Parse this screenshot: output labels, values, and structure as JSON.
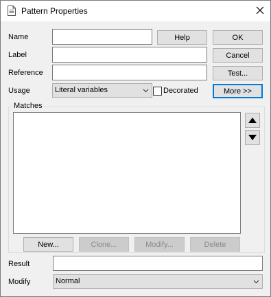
{
  "window": {
    "title": "Pattern Properties"
  },
  "icons": {
    "title_icon": "document-icon",
    "close_icon": "close-icon",
    "up_icon": "arrow-up-icon",
    "down_icon": "arrow-down-icon",
    "dropdown_icon": "chevron-down-icon"
  },
  "form": {
    "name_label": "Name",
    "name_value": "",
    "label_label": "Label",
    "label_value": "",
    "reference_label": "Reference",
    "reference_value": "",
    "usage_label": "Usage",
    "usage_selected": "Literal variables",
    "decorated_label": "Decorated",
    "decorated_checked": false,
    "result_label": "Result",
    "result_value": "",
    "modify_label": "Modify",
    "modify_selected": "Normal"
  },
  "buttons": {
    "help": "Help",
    "ok": "OK",
    "cancel": "Cancel",
    "test": "Test...",
    "more": "More >>"
  },
  "matches": {
    "legend": "Matches",
    "items": [],
    "new": "New...",
    "clone": "Clone...",
    "modify": "Modify...",
    "delete": "Delete"
  },
  "colors": {
    "focus_border": "#0078d7",
    "window_bg": "#f0f0f0",
    "button_bg": "#e1e1e1"
  }
}
